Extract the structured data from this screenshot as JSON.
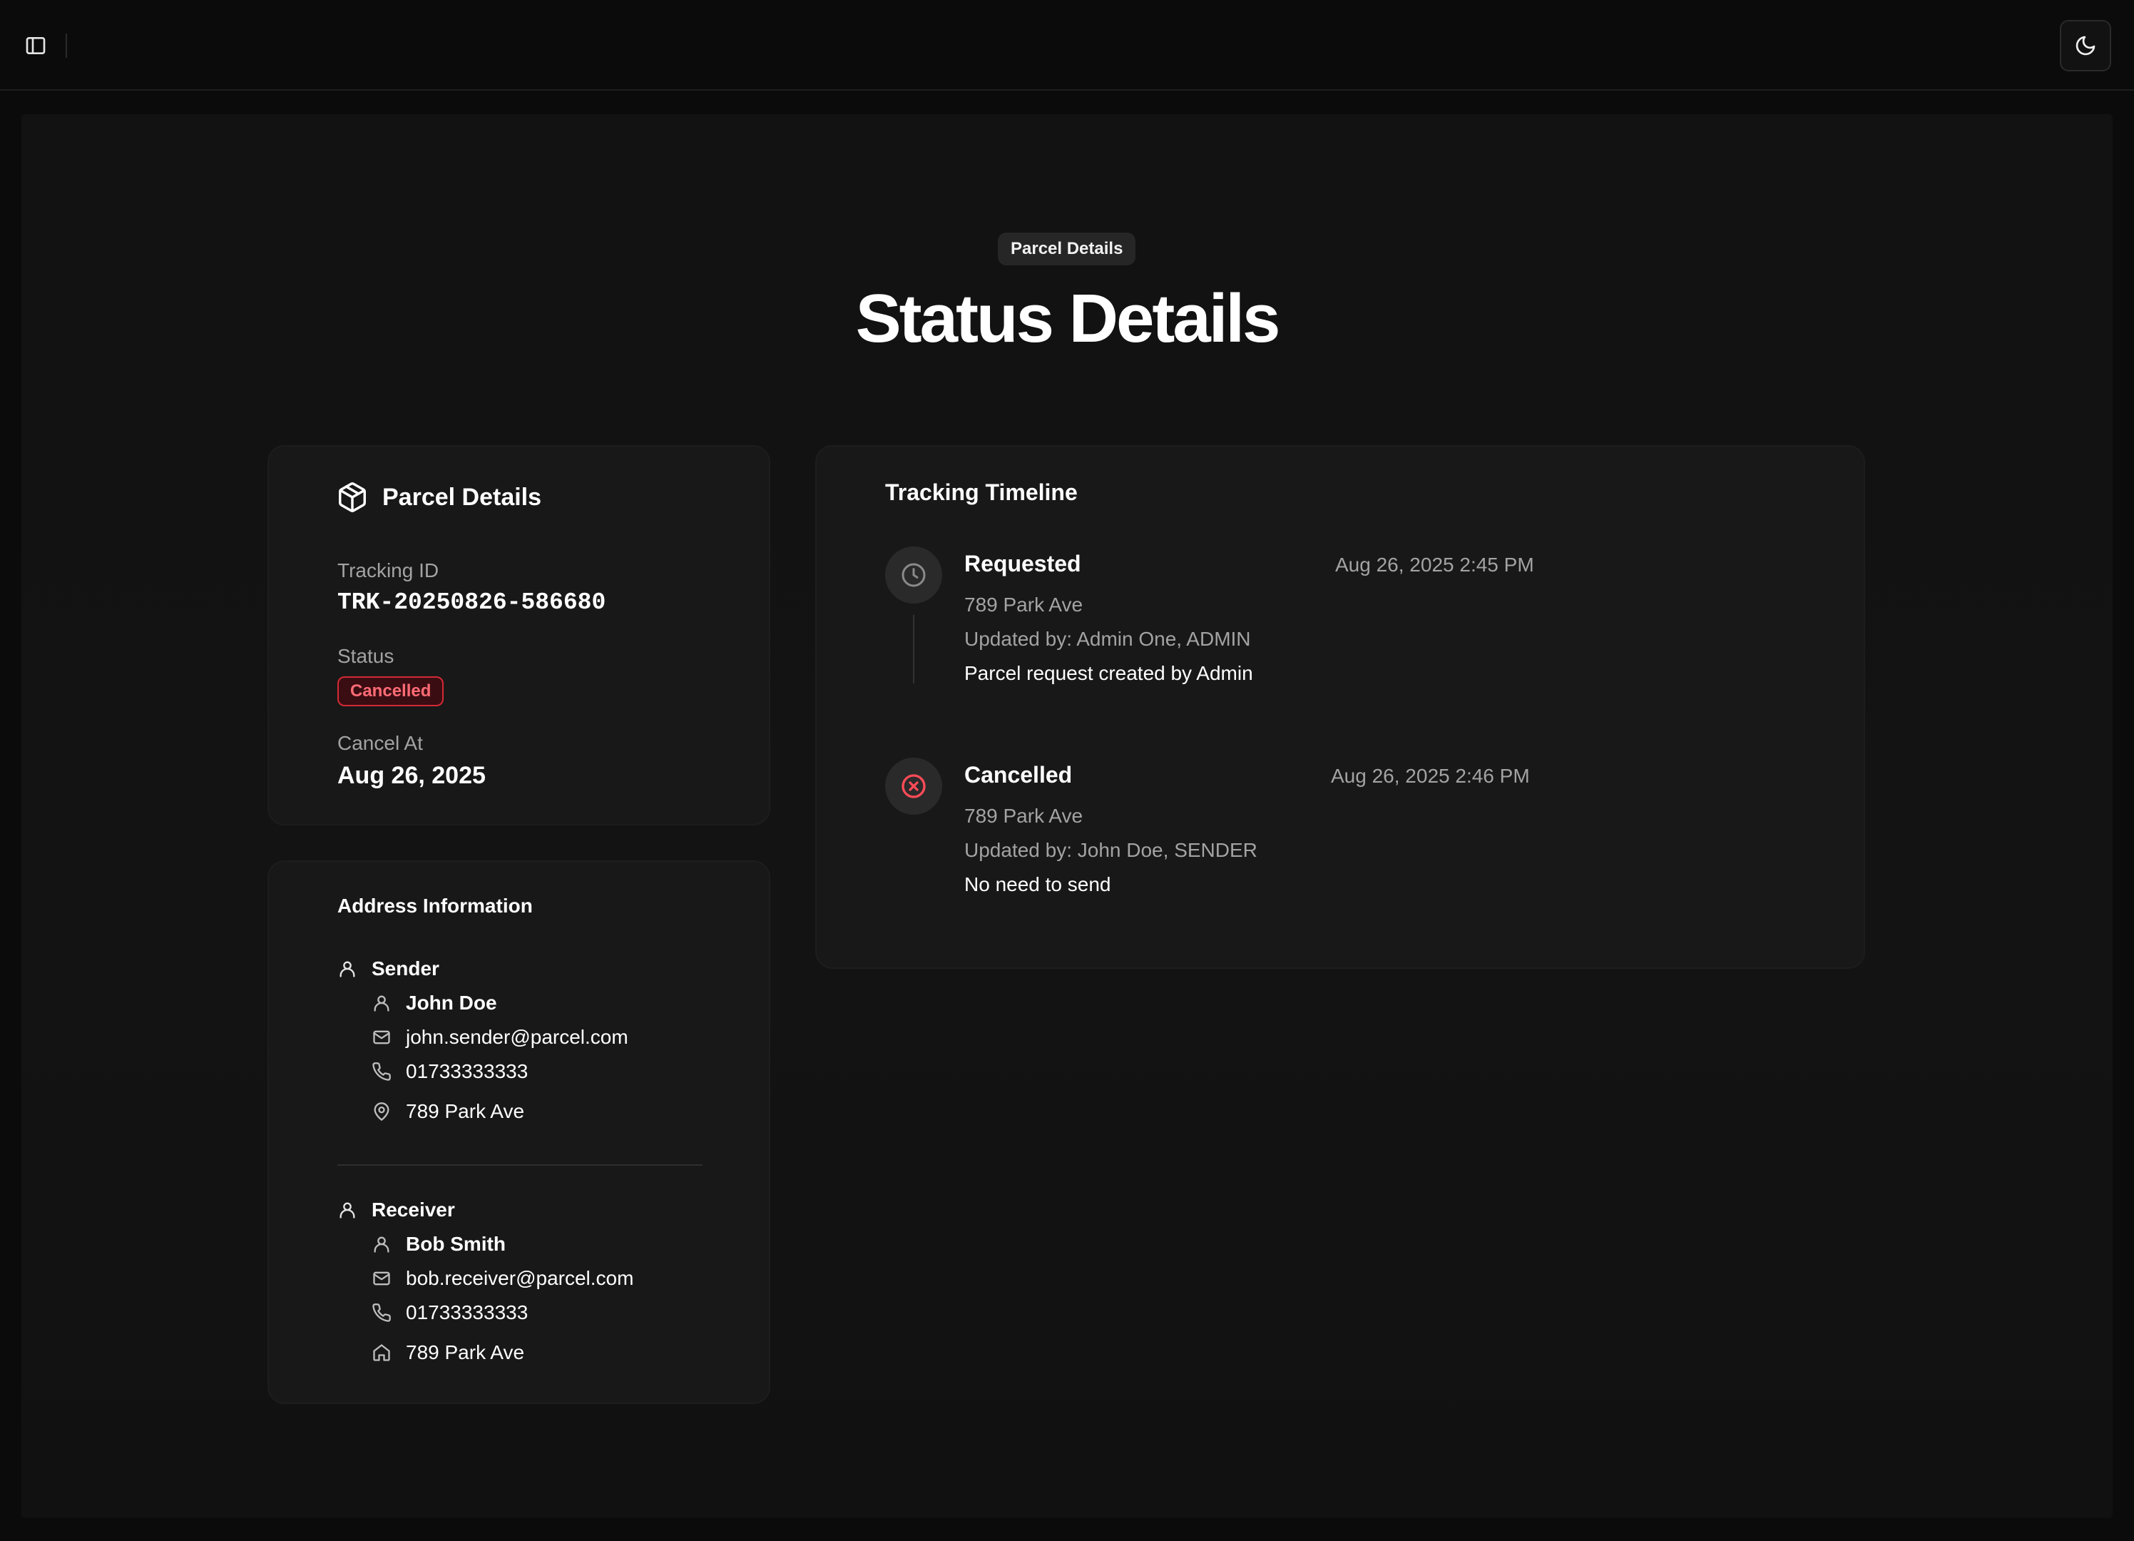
{
  "topbar": {
    "sidebar_icon": "sidebar-toggle-icon",
    "theme_icon": "moon-icon"
  },
  "header": {
    "badge": "Parcel Details",
    "title": "Status Details"
  },
  "parcel_card": {
    "icon": "package-icon",
    "title": "Parcel Details",
    "tracking_label": "Tracking ID",
    "tracking_id": "TRK-20250826-586680",
    "status_label": "Status",
    "status_value": "Cancelled",
    "cancel_label": "Cancel At",
    "cancel_date": "Aug 26, 2025"
  },
  "address_card": {
    "title": "Address Information",
    "sender": {
      "heading": "Sender",
      "name": "John Doe",
      "email": "john.sender@parcel.com",
      "phone": "01733333333",
      "address": "789 Park Ave"
    },
    "receiver": {
      "heading": "Receiver",
      "name": "Bob Smith",
      "email": "bob.receiver@parcel.com",
      "phone": "01733333333",
      "address": "789 Park Ave"
    }
  },
  "timeline": {
    "title": "Tracking Timeline",
    "events": [
      {
        "status": "Requested",
        "timestamp": "Aug 26, 2025 2:45 PM",
        "location": "789 Park Ave",
        "updated_by": "Updated by: Admin One, ADMIN",
        "note": "Parcel request created by Admin",
        "icon": "clock-icon"
      },
      {
        "status": "Cancelled",
        "timestamp": "Aug 26, 2025 2:46 PM",
        "location": "789 Park Ave",
        "updated_by": "Updated by: John Doe, SENDER",
        "note": "No need to send",
        "icon": "x-circle-icon"
      }
    ]
  },
  "colors": {
    "background": "#0b0b0b",
    "card": "#181818",
    "danger": "#ff4b57",
    "muted_text": "#a3a3a3"
  }
}
